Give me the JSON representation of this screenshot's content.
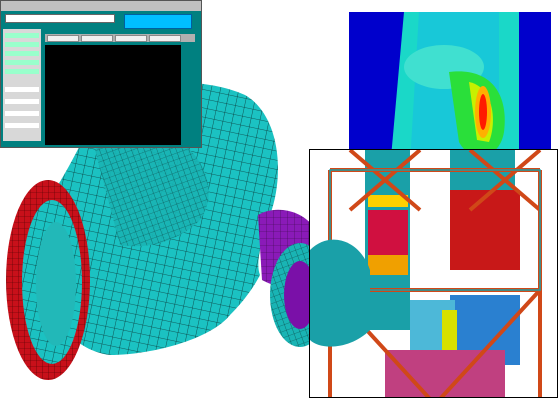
{
  "colors": {
    "mesh_body": "#1bc2c2",
    "mesh_lines": "#0a3a3a",
    "flange": "#c8101a",
    "connector": "#8a1ab8",
    "stress_background": "#0000cc",
    "stress_green": "#2adf3a",
    "stress_hot": "#ff1a00",
    "frame_beam": "#d04818",
    "frame_teal": "#1aa0a8"
  },
  "icons": [
    "fe-software-window",
    "stress-contour-plot",
    "frame-structure-model",
    "pipe-elbow-mesh"
  ]
}
